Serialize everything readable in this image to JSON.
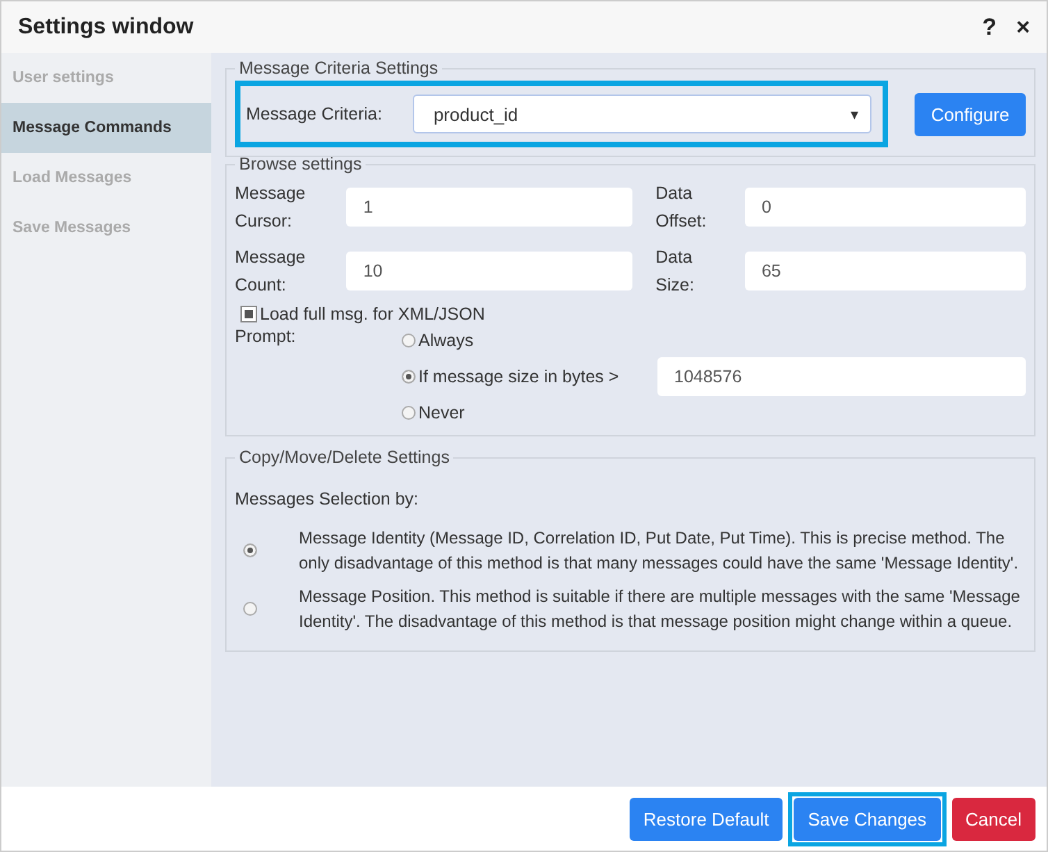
{
  "window": {
    "title": "Settings window",
    "help": "?",
    "close": "×"
  },
  "sidebar": {
    "items": [
      {
        "label": "User settings",
        "selected": false
      },
      {
        "label": "Message Commands",
        "selected": true
      },
      {
        "label": "Load Messages",
        "selected": false
      },
      {
        "label": "Save Messages",
        "selected": false
      }
    ]
  },
  "criteria": {
    "legend": "Message Criteria Settings",
    "label": "Message Criteria:",
    "value": "product_id",
    "caret": "▾",
    "highlighted": true,
    "button": "Configure"
  },
  "browse": {
    "legend": "Browse settings",
    "fields": [
      {
        "label": "Message Cursor:",
        "value": "1"
      },
      {
        "label": "Data Offset:",
        "value": "0"
      },
      {
        "label": "Message Count:",
        "value": "10"
      },
      {
        "label": "Data Size:",
        "value": "65"
      }
    ],
    "load_full": {
      "label": "Load full msg. for XML/JSON",
      "checked": true
    },
    "prompt_label": "Prompt:",
    "prompt_options": [
      {
        "label": "Always",
        "selected": false
      },
      {
        "label": "If message size in bytes >",
        "selected": true,
        "value": "1048576"
      },
      {
        "label": "Never",
        "selected": false
      }
    ]
  },
  "copy": {
    "legend": "Copy/Move/Delete Settings",
    "label": "Messages Selection by:",
    "options": [
      {
        "label": "Message Identity (Message ID, Correlation ID, Put Date, Put Time). This is precise method. The only disadvantage of this method is that many messages could have the same 'Message Identity'.",
        "selected": true
      },
      {
        "label": "Message Position. This method is suitable if there are multiple messages with the same 'Message Identity'. The disadvantage of this method is that message position might change within a queue.",
        "selected": false
      }
    ]
  },
  "buttons": [
    {
      "label": "Restore Default",
      "kind": "primary",
      "highlighted": false
    },
    {
      "label": "Save Changes",
      "kind": "primary",
      "highlighted": true
    },
    {
      "label": "Cancel",
      "kind": "danger",
      "highlighted": false
    }
  ]
}
